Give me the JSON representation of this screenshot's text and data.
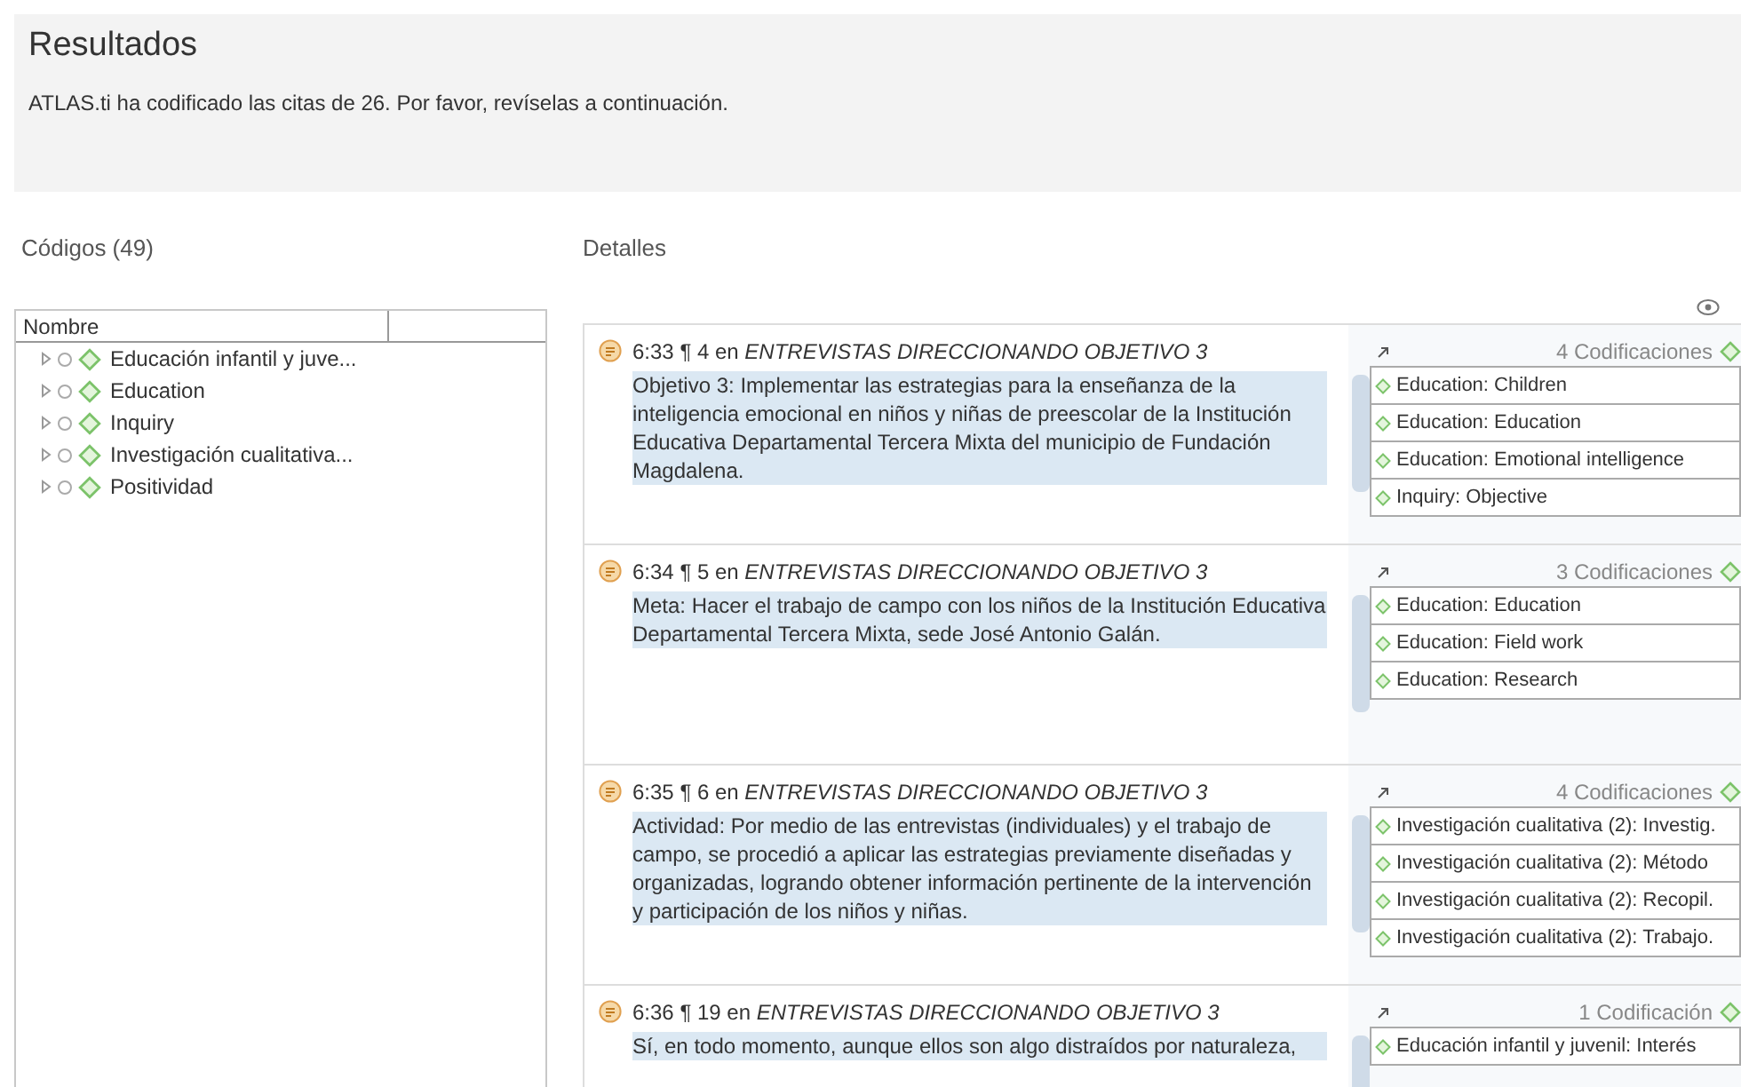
{
  "header": {
    "title": "Resultados",
    "message": "ATLAS.ti ha codificado las citas de 26. Por favor, revíselas a continuación."
  },
  "codes_panel": {
    "title": "Códigos (49)",
    "column": "Nombre",
    "items": [
      {
        "label": "Educación infantil y juve..."
      },
      {
        "label": "Education"
      },
      {
        "label": "Inquiry"
      },
      {
        "label": "Investigación cualitativa..."
      },
      {
        "label": "Positividad"
      }
    ]
  },
  "details_panel": {
    "title": "Detalles",
    "quotes": [
      {
        "head": "6:33 ¶ 4 en",
        "document": "ENTREVISTAS DIRECCIONANDO OBJETIVO 3",
        "text": "Objetivo 3: Implementar las estrategias para la enseñanza de la inteligencia emocional en niños y niñas de preescolar de la Institución Educativa Departamental Tercera Mixta del municipio de Fundación Magdalena.",
        "count": "4 Codificaciones",
        "codes": [
          "Education: Children",
          "Education: Education",
          "Education: Emotional intelligence",
          "Inquiry: Objective"
        ]
      },
      {
        "head": "6:34 ¶ 5 en",
        "document": "ENTREVISTAS DIRECCIONANDO OBJETIVO 3",
        "text": "Meta: Hacer el trabajo de campo con los niños de la Institución Educativa Departamental Tercera Mixta, sede José Antonio Galán.",
        "count": "3 Codificaciones",
        "codes": [
          "Education: Education",
          "Education: Field work",
          "Education: Research"
        ]
      },
      {
        "head": "6:35 ¶ 6 en",
        "document": "ENTREVISTAS DIRECCIONANDO OBJETIVO 3",
        "text": "Actividad: Por medio de las entrevistas (individuales) y el trabajo de campo, se procedió a aplicar las estrategias previamente diseñadas y organizadas, logrando obtener información pertinente de la intervención y participación de los niños y niñas.",
        "count": "4 Codificaciones",
        "codes": [
          "Investigación cualitativa (2): Investig.",
          "Investigación cualitativa (2): Método",
          "Investigación cualitativa (2): Recopil.",
          "Investigación cualitativa (2): Trabajo."
        ]
      },
      {
        "head": "6:36 ¶ 19 en",
        "document": "ENTREVISTAS DIRECCIONANDO OBJETIVO 3",
        "text": "Sí, en todo momento, aunque ellos son algo distraídos por naturaleza,",
        "count": "1 Codificación",
        "codes": [
          "Educación infantil y juvenil: Interés"
        ]
      }
    ]
  }
}
